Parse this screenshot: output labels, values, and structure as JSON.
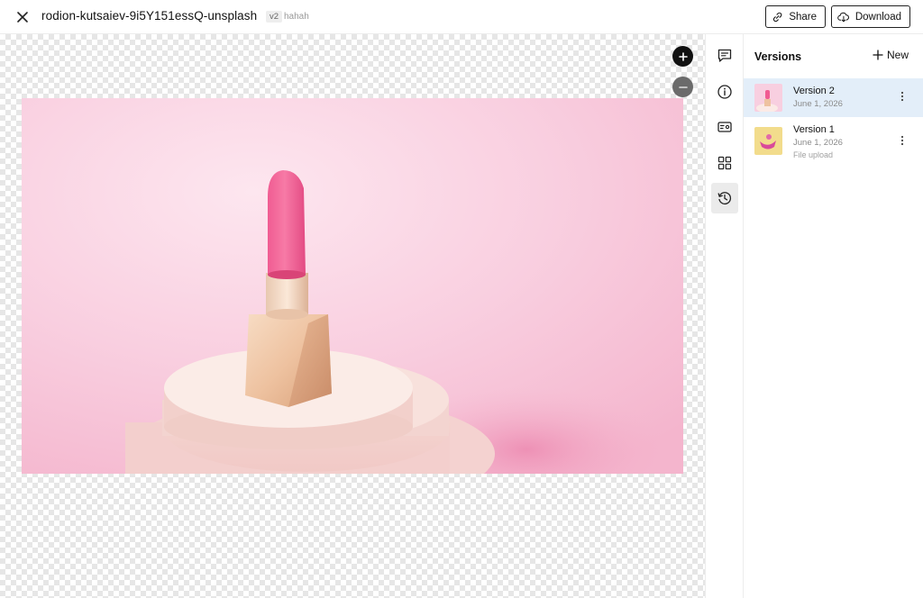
{
  "header": {
    "title": "rodion-kutsaiev-9i5Y151essQ-unsplash",
    "version_badge": "v2",
    "version_note": "hahah",
    "share_label": "Share",
    "download_label": "Download",
    "icons": {
      "close": "close-icon",
      "share": "link-icon",
      "download": "cloud-download-icon"
    }
  },
  "canvas": {
    "zoom_in_icon": "plus-icon",
    "zoom_out_icon": "minus-icon",
    "image_subject": "pink lipstick on round pedestal"
  },
  "rail": {
    "items": [
      {
        "icon": "comment-icon",
        "active": false
      },
      {
        "icon": "info-icon",
        "active": false
      },
      {
        "icon": "id-card-icon",
        "active": false
      },
      {
        "icon": "grid-icon",
        "active": false
      },
      {
        "icon": "history-icon",
        "active": true
      }
    ]
  },
  "versions": {
    "title": "Versions",
    "new_label": "New",
    "items": [
      {
        "name": "Version 2",
        "date": "June 1, 2026",
        "note": "",
        "selected": true,
        "thumb": "pink"
      },
      {
        "name": "Version 1",
        "date": "June 1, 2026",
        "note": "File upload",
        "selected": false,
        "thumb": "yellow"
      }
    ]
  },
  "colors": {
    "accent_selected": "#e3eef9",
    "text_primary": "#111111",
    "text_muted": "#8a8a8a"
  }
}
